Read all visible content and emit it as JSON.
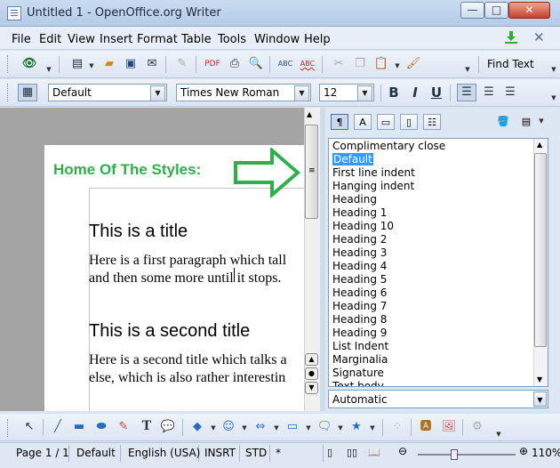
{
  "window": {
    "title": "Untitled 1 - OpenOffice.org Writer",
    "min": "—",
    "max": "□",
    "close": "✕"
  },
  "menu": [
    "File",
    "Edit",
    "View",
    "Insert",
    "Format",
    "Table",
    "Tools",
    "Window",
    "Help"
  ],
  "toolbar": {
    "find_text": "Find Text"
  },
  "format": {
    "style": "Default",
    "font": "Times New Roman",
    "size": "12",
    "bold": "B",
    "italic": "I",
    "underline": "U"
  },
  "document": {
    "header": "Home Of The Styles:",
    "title1": "This is a title",
    "para1": [
      "Here is a first paragraph which tall",
      "and then some more until it stops."
    ],
    "title2": "This is a second title",
    "para2": [
      "Here is a second title which talks a",
      "else, which is also rather interestin"
    ]
  },
  "styles": {
    "items": [
      "Complimentary close",
      "Default",
      "First line indent",
      "Hanging indent",
      "Heading",
      "Heading 1",
      "Heading 10",
      "Heading 2",
      "Heading 3",
      "Heading 4",
      "Heading 5",
      "Heading 6",
      "Heading 7",
      "Heading 8",
      "Heading 9",
      "List Indent",
      "Marginalia",
      "Signature",
      "Text body"
    ],
    "selected": "Default",
    "filter": "Automatic"
  },
  "status": {
    "page": "Page 1 / 1",
    "style": "Default",
    "lang": "English (USA)",
    "mode": "INSRT",
    "sel": "STD",
    "mod": "*",
    "zoom": "110%"
  },
  "colors": {
    "accent": "#2daf4b",
    "selection": "#3399ff"
  }
}
